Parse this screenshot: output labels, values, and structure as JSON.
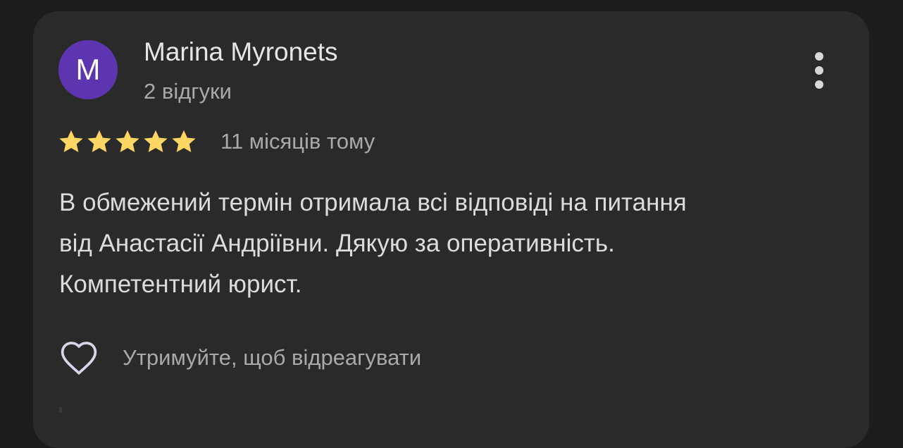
{
  "review": {
    "author_initial": "M",
    "author_name": "Marina Myronets",
    "author_reviews": "2 відгуки",
    "rating": 5,
    "rating_max": 5,
    "time_ago": "11 місяців тому",
    "text_lines": [
      "В обмежений термін отримала всі відповіді на питання",
      "від Анастасії Андріївни. Дякую за оперативність.",
      "Компетентний юрист."
    ],
    "react_label": "Утримуйте, щоб відреагувати"
  },
  "icons": {
    "more": "more-vert-icon",
    "star": "star-icon",
    "heart": "heart-outline-icon"
  },
  "colors": {
    "background": "#1c1c1c",
    "card": "#2a2a2b",
    "avatar": "#5e35b1",
    "star": "#fdd663",
    "primary_text": "#e6e6e6",
    "secondary_text": "#a9a9a9"
  }
}
